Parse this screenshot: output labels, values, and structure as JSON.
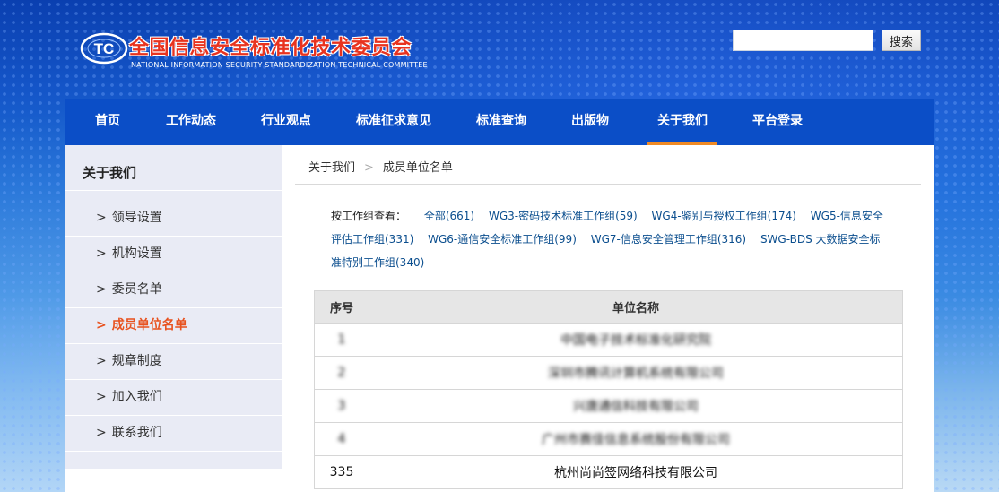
{
  "header": {
    "logo_mark": "TC",
    "title": "全国信息安全标准化技术委员会",
    "subtitle": "NATIONAL INFORMATION SECURITY STANDARDIZATION TECHNICAL COMMITTEE",
    "title_color": "#e8331f"
  },
  "search": {
    "value": "",
    "placeholder": "",
    "button_label": "搜索"
  },
  "nav": {
    "active_color": "#f08a24",
    "items": [
      {
        "label": "首页"
      },
      {
        "label": "工作动态"
      },
      {
        "label": "行业观点"
      },
      {
        "label": "标准征求意见"
      },
      {
        "label": "标准查询"
      },
      {
        "label": "出版物"
      },
      {
        "label": "关于我们",
        "active": true
      },
      {
        "label": "平台登录"
      }
    ]
  },
  "sidebar": {
    "title": "关于我们",
    "items": [
      {
        "label": "领导设置"
      },
      {
        "label": "机构设置"
      },
      {
        "label": "委员名单"
      },
      {
        "label": "成员单位名单",
        "active": true
      },
      {
        "label": "规章制度"
      },
      {
        "label": "加入我们"
      },
      {
        "label": "联系我们"
      }
    ]
  },
  "breadcrumb": {
    "parent": "关于我们",
    "separator": ">",
    "current": "成员单位名单"
  },
  "filter": {
    "label": "按工作组查看：",
    "links": [
      {
        "label": "全部(661)"
      },
      {
        "label": "WG3-密码技术标准工作组(59)"
      },
      {
        "label": "WG4-鉴别与授权工作组(174)"
      },
      {
        "label": "WG5-信息安全评估工作组(331)"
      },
      {
        "label": "WG6-通信安全标准工作组(99)"
      },
      {
        "label": "WG7-信息安全管理工作组(316)"
      },
      {
        "label": "SWG-BDS 大数据安全标准特别工作组(340)"
      }
    ]
  },
  "table": {
    "headers": {
      "no": "序号",
      "name": "单位名称"
    },
    "rows": [
      {
        "no": "1",
        "name": "中国电子技术标准化研究院",
        "blurred": true
      },
      {
        "no": "2",
        "name": "深圳市腾讯计算机系统有限公司",
        "blurred": true
      },
      {
        "no": "3",
        "name": "兴唐通信科技有限公司",
        "blurred": true
      },
      {
        "no": "4",
        "name": "广州市赛佳信息系统股份有限公司",
        "blurred": true
      },
      {
        "no": "335",
        "name": "杭州尚尚签网络科技有限公司",
        "blurred": false
      }
    ]
  }
}
